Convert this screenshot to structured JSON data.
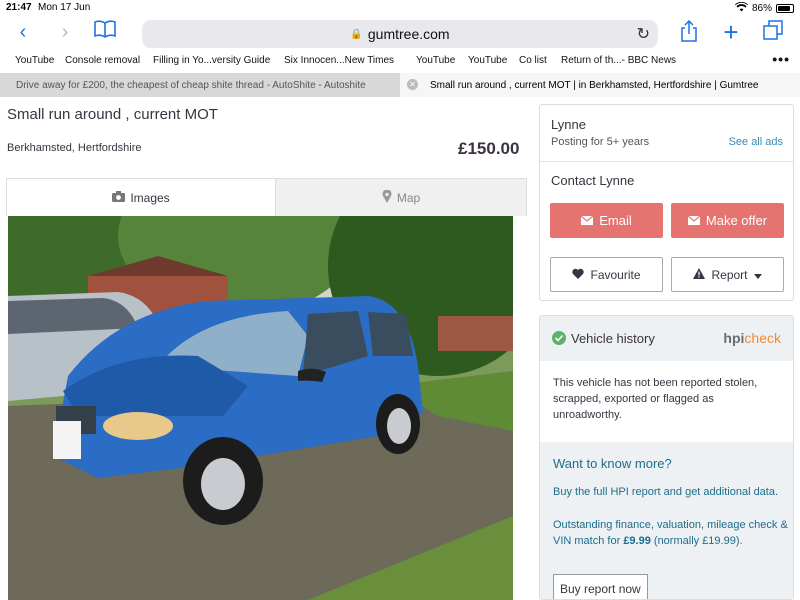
{
  "status_bar": {
    "time": "21:47",
    "date": "Mon 17 Jun",
    "battery": "86%",
    "battery_level": 0.86
  },
  "browser": {
    "url": "gumtree.com",
    "bookmarks": [
      "YouTube",
      "Console removal",
      "Filling in Yo...versity Guide",
      "Six Innocen...New Times",
      "YouTube",
      "YouTube",
      "Co list",
      "Return of th...- BBC News"
    ],
    "tabs": [
      {
        "title": "Drive away for £200, the cheapest of cheap shite thread - AutoShite - Autoshite",
        "active": false
      },
      {
        "title": "Small run around , current MOT | in Berkhamsted, Hertfordshire | Gumtree",
        "active": true
      }
    ]
  },
  "listing": {
    "title": "Small run around , current MOT",
    "location": "Berkhamsted, Hertfordshire",
    "price": "£150.00",
    "media_tabs": {
      "images": "Images",
      "map": "Map"
    }
  },
  "seller": {
    "name": "Lynne",
    "posting_since": "Posting for 5+ years",
    "see_all": "See all ads",
    "contact_heading": "Contact Lynne",
    "email_label": "Email",
    "offer_label": "Make offer",
    "favourite_label": "Favourite",
    "report_label": "Report"
  },
  "vehicle_history": {
    "title": "Vehicle history",
    "brand_main": "hpi",
    "brand_accent": "check",
    "text": "This vehicle has not been reported stolen, scrapped, exported or flagged as unroadworthy.",
    "want_heading": "Want to know more?",
    "buy_text": "Buy the full HPI report and get additional data.",
    "details_text": "Outstanding finance, valuation, mileage check & VIN match for",
    "price": "£9.99",
    "normally": "(normally £19.99).",
    "button_label": "Buy report now"
  },
  "colors": {
    "accent_red": "#e57470",
    "link_blue": "#3c8ab5",
    "ios_blue": "#1a73e8",
    "car_blue": "#2b6cc4"
  }
}
